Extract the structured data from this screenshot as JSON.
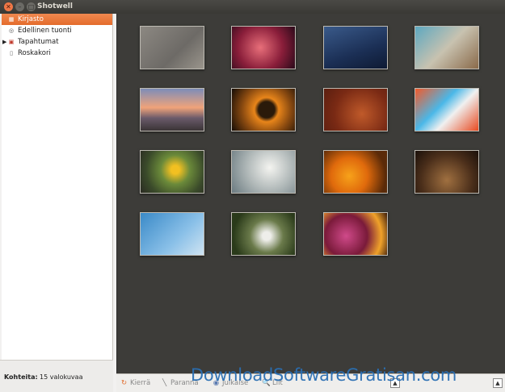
{
  "window": {
    "title": "Shotwell"
  },
  "sidebar": {
    "items": [
      {
        "label": "Kirjasto",
        "icon": "library-icon",
        "active": true
      },
      {
        "label": "Edellinen tuonti",
        "icon": "import-icon"
      },
      {
        "label": "Tapahtumat",
        "icon": "events-icon",
        "expander": "▶"
      },
      {
        "label": "Roskakori",
        "icon": "trash-icon"
      }
    ]
  },
  "status": {
    "count_label": "Kohteita:",
    "count_value": "15 valokuvaa"
  },
  "toolbar": {
    "rotate_label": "Kierrä",
    "enhance_label": "Paranna",
    "publish_label": "Julkaise",
    "crop_label": "Liit"
  },
  "watermark": "DownloadSoftwareGratisan.com",
  "thumbnails": [
    {
      "name": "photo-dry-grass",
      "bg": "linear-gradient(135deg,#8c8882,#6d6a66 60%,#9a958c)"
    },
    {
      "name": "photo-ubuntu-wallpaper",
      "bg": "radial-gradient(circle at 45% 50%,#e86f7a,#8a1e3a 55%,#2a0a1a)"
    },
    {
      "name": "photo-blue-tiles",
      "bg": "linear-gradient(160deg,#3a5a8a,#1b2f55 60%,#0e1a33)"
    },
    {
      "name": "photo-rope",
      "bg": "linear-gradient(135deg,#5da8c0,#c8c2b0 50%,#8a6a4a)"
    },
    {
      "name": "photo-sunset-city",
      "bg": "linear-gradient(#7d8db8,#f0a37a 45%,#6a5a6a 70%,#3a3436)"
    },
    {
      "name": "photo-speaker",
      "bg": "radial-gradient(circle at 55% 50%,#2a1a0a 20%,#e8851a 30%,#8a4a10 60%,#140c06)"
    },
    {
      "name": "photo-lizard",
      "bg": "radial-gradient(circle at 60% 60%,#c05a2a,#7a2a14 60%,#5a1e10)"
    },
    {
      "name": "photo-graffiti",
      "bg": "linear-gradient(135deg,#f25a2a,#4ab8e8 40%,#f0f0f0 60%,#e84a20)"
    },
    {
      "name": "photo-yellow-flower",
      "bg": "radial-gradient(circle at 55% 45%,#f2c021 10%,#6b8a3a 35%,#3a4a2a 70%,#2a2a22)"
    },
    {
      "name": "photo-clock",
      "bg": "radial-gradient(circle at 60% 40%,#f4f4f0,#b0b8b8 50%,#6a7a80)"
    },
    {
      "name": "photo-orange-flower",
      "bg": "radial-gradient(circle at 40% 60%,#f7a21a,#e06a0c 40%,#5a2a08 80%)"
    },
    {
      "name": "photo-wooden-room",
      "bg": "radial-gradient(circle at 50% 70%,#a07040,#4a2e1a 60%,#1a100a)"
    },
    {
      "name": "photo-birds-sky",
      "bg": "linear-gradient(135deg,#3a8ac8,#8ac0e8 60%,#d0e4f2)"
    },
    {
      "name": "photo-white-flower",
      "bg": "radial-gradient(circle at 55% 55%,#eeeeea 10%,#6a7a4a 40%,#2a3a1a 80%)"
    },
    {
      "name": "photo-purple-flower",
      "bg": "radial-gradient(circle at 35% 55%,#d04a8a,#7a1a3a 45%,#f0a22a 75%,#3a1a0a)"
    }
  ]
}
